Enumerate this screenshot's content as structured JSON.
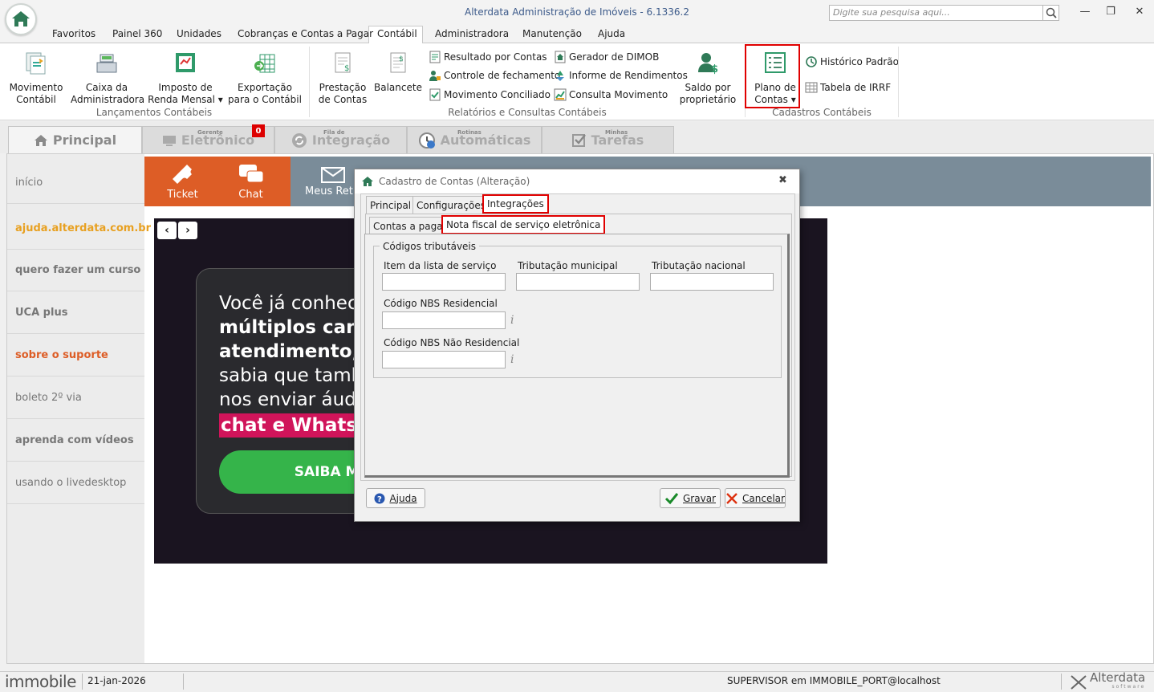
{
  "window": {
    "title": "Alterdata Administração de Imóveis - 6.1336.2",
    "search_placeholder": "Digite sua pesquisa aqui...",
    "controls": [
      "minimize",
      "restore",
      "close"
    ]
  },
  "menu": {
    "items": [
      "Favoritos",
      "Painel 360",
      "Unidades",
      "Cobranças e Contas a Pagar",
      "Contábil",
      "Administradora",
      "Manutenção",
      "Ajuda"
    ],
    "active": "Contábil"
  },
  "ribbon": {
    "groups": [
      {
        "label": "Lançamentos Contábeis",
        "buttons": [
          {
            "label1": "Movimento",
            "label2": "Contábil"
          },
          {
            "label1": "Caixa da",
            "label2": "Administradora"
          },
          {
            "label1": "Imposto de",
            "label2": "Renda Mensal ▾"
          },
          {
            "label1": "Exportação",
            "label2": "para o Contábil"
          }
        ]
      },
      {
        "label": "Relatórios e Consultas Contábeis",
        "buttons": [
          {
            "label1": "Prestação",
            "label2": "de Contas"
          },
          {
            "label1": "Balancete",
            "label2": ""
          },
          {
            "label1": "Saldo por",
            "label2": "proprietário"
          }
        ],
        "small": [
          "Resultado por Contas",
          "Controle de fechamento",
          "Movimento Conciliado",
          "Gerador de DIMOB",
          "Informe de Rendimentos",
          "Consulta Movimento"
        ]
      },
      {
        "label": "Cadastros Contábeis",
        "buttons": [
          {
            "label1": "Plano de",
            "label2": "Contas ▾"
          }
        ],
        "small": [
          "Histórico Padrão",
          "Tabela de IRRF"
        ]
      }
    ]
  },
  "big_tabs": [
    {
      "label": "Principal",
      "small": ""
    },
    {
      "label": "Eletrônico",
      "small": "Gerente",
      "badge": "0"
    },
    {
      "label": "Integração",
      "small": "Fila de"
    },
    {
      "label": "Automáticas",
      "small": "Rotinas"
    },
    {
      "label": "Tarefas",
      "small": "Minhas"
    }
  ],
  "left_nav": [
    {
      "label": "início",
      "color": "#777777",
      "bold": false
    },
    {
      "label": "ajuda.alterdata.com.br",
      "color": "#e8a020",
      "bold": true
    },
    {
      "label": "quero fazer um curso",
      "color": "#777777",
      "bold": true
    },
    {
      "label": "UCA plus",
      "color": "#777777",
      "bold": true
    },
    {
      "label": "sobre o suporte",
      "color": "#dd5d26",
      "bold": true
    },
    {
      "label": "boleto 2º via",
      "color": "#777777",
      "bold": false
    },
    {
      "label": "aprenda com vídeos",
      "color": "#777777",
      "bold": true
    },
    {
      "label": "usando o livedesktop",
      "color": "#777777",
      "bold": false
    }
  ],
  "support_bar": {
    "ticket": "Ticket",
    "chat": "Chat",
    "meus": "Meus Ret"
  },
  "banner": {
    "lines": [
      "Você já conhec",
      "múltiplos cana",
      "atendimento, n",
      "sabia que tamb",
      "nos enviar áud",
      "chat e WhatsA"
    ],
    "cta": "SAIBA MAIS"
  },
  "dialog": {
    "title": "Cadastro de Contas (Alteração)",
    "tabs": [
      "Principal",
      "Configurações",
      "Integrações"
    ],
    "active_tab": "Integrações",
    "subtabs": [
      "Contas a pagar",
      "Nota fiscal de serviço eletrônica"
    ],
    "active_subtab": "Nota fiscal de serviço eletrônica",
    "group_title": "Códigos tributáveis",
    "fields": {
      "item_lista": {
        "label": "Item da lista de serviço",
        "value": ""
      },
      "trib_municipal": {
        "label": "Tributação municipal",
        "value": ""
      },
      "trib_nacional": {
        "label": "Tributação nacional",
        "value": ""
      },
      "nbs_residencial": {
        "label": "Código NBS Residencial",
        "value": ""
      },
      "nbs_nao_residencial": {
        "label": "Código NBS Não Residencial",
        "value": ""
      }
    },
    "buttons": {
      "help": "Ajuda",
      "save": "Gravar",
      "cancel": "Cancelar"
    }
  },
  "status": {
    "brand": "immobile",
    "date": "21-jan-2026",
    "user": "SUPERVISOR em IMMOBILE_PORT@localhost",
    "vendor": "Alterdata",
    "vendor_sub": "software"
  },
  "colors": {
    "accent_orange": "#dd5d26",
    "highlight_red": "#e00000",
    "cta_green": "#35b44a",
    "wa_pink": "#d0145a"
  }
}
